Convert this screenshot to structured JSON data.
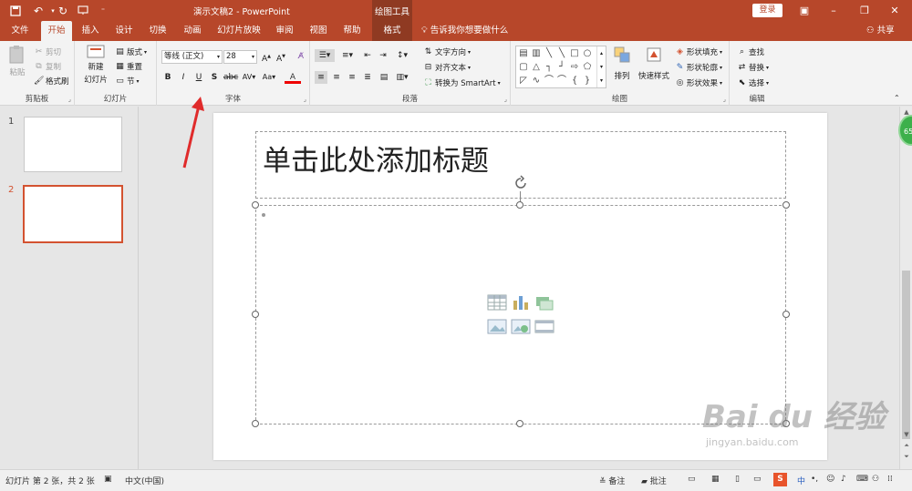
{
  "titlebar": {
    "doc_title": "演示文稿2  -  PowerPoint",
    "context_tab": "绘图工具",
    "login": "登录",
    "qa_icons": [
      "save-icon",
      "undo-icon",
      "redo-icon",
      "present-from-start-icon",
      "customize-qa-icon"
    ]
  },
  "tabs": {
    "items": [
      "文件",
      "开始",
      "插入",
      "设计",
      "切换",
      "动画",
      "幻灯片放映",
      "审阅",
      "视图",
      "帮助",
      "格式"
    ],
    "tell_me": "告诉我你想要做什么",
    "share": "共享"
  },
  "ribbon": {
    "clipboard": {
      "paste": "粘贴",
      "cut": "剪切",
      "copy": "复制",
      "format_painter": "格式刷",
      "label": "剪贴板"
    },
    "slides": {
      "new_slide_1": "新建",
      "new_slide_2": "幻灯片",
      "layout": "版式",
      "reset": "重置",
      "section": "节",
      "label": "幻灯片"
    },
    "font": {
      "font_name": "等线 (正文)",
      "font_size": "28",
      "label": "字体"
    },
    "paragraph": {
      "text_direction": "文字方向",
      "align_text": "对齐文本",
      "smartart": "转换为 SmartArt",
      "label": "段落"
    },
    "drawing": {
      "arrange": "排列",
      "quick_styles": "快速样式",
      "shape_fill": "形状填充",
      "shape_outline": "形状轮廓",
      "shape_effects": "形状效果",
      "label": "绘图"
    },
    "editing": {
      "find": "查找",
      "replace": "替换",
      "select": "选择",
      "label": "编辑"
    }
  },
  "slides_pane": {
    "numbers": [
      "1",
      "2"
    ]
  },
  "slide": {
    "title_placeholder": "单击此处添加标题"
  },
  "statusbar": {
    "slide_info": "幻灯片 第 2 张，共 2 张",
    "language": "中文(中国)",
    "notes": "备注",
    "comments": "批注",
    "ime": "中"
  },
  "badge": "65",
  "watermark": {
    "brand": "Bai du 经验",
    "url": "jingyan.baidu.com"
  },
  "colors": {
    "accent": "#b7472a",
    "context_tab": "#8f3a22",
    "selected_thumb": "#d35230"
  }
}
